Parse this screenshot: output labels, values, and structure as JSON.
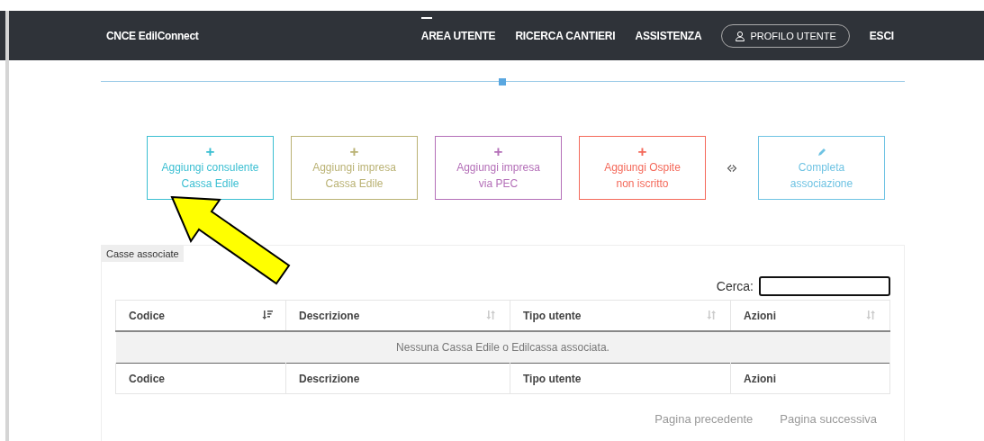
{
  "navbar": {
    "brand": "CNCE EdilConnect",
    "links": [
      {
        "label": "AREA UTENTE",
        "selected": true
      },
      {
        "label": "RICERCA CANTIERI",
        "selected": false
      },
      {
        "label": "ASSISTENZA",
        "selected": false
      }
    ],
    "profile_button": "PROFILO UTENTE",
    "logout": "ESCI"
  },
  "actions": [
    {
      "kind": "add",
      "icon": "+",
      "label": "Aggiungi consulente",
      "sublabel": "Cassa Edile",
      "color": "#3bbfd2"
    },
    {
      "kind": "add",
      "icon": "+",
      "label": "Aggiungi impresa",
      "sublabel": "Cassa Edile",
      "color": "#bab274"
    },
    {
      "kind": "add",
      "icon": "+",
      "label": "Aggiungi impresa",
      "sublabel": "via PEC",
      "color": "#b46fb8"
    },
    {
      "kind": "add",
      "icon": "+",
      "label": "Aggiungi Ospite",
      "sublabel": "non iscritto",
      "color": "#f4695a"
    },
    {
      "kind": "separator"
    },
    {
      "kind": "edit",
      "label": "Completa",
      "sublabel": "associazione",
      "color": "#6fc3e3"
    }
  ],
  "panel": {
    "tab": "Casse associate",
    "search_label": "Cerca:",
    "columns": [
      {
        "label": "Codice",
        "sorted": true
      },
      {
        "label": "Descrizione",
        "sorted": false
      },
      {
        "label": "Tipo utente",
        "sorted": false
      },
      {
        "label": "Azioni",
        "sorted": false
      }
    ],
    "empty_message": "Nessuna Cassa Edile o Edilcassa associata.",
    "footer_columns": [
      "Codice",
      "Descrizione",
      "Tipo utente",
      "Azioni"
    ],
    "pagination": [
      "Pagina precedente",
      "Pagina successiva"
    ]
  }
}
